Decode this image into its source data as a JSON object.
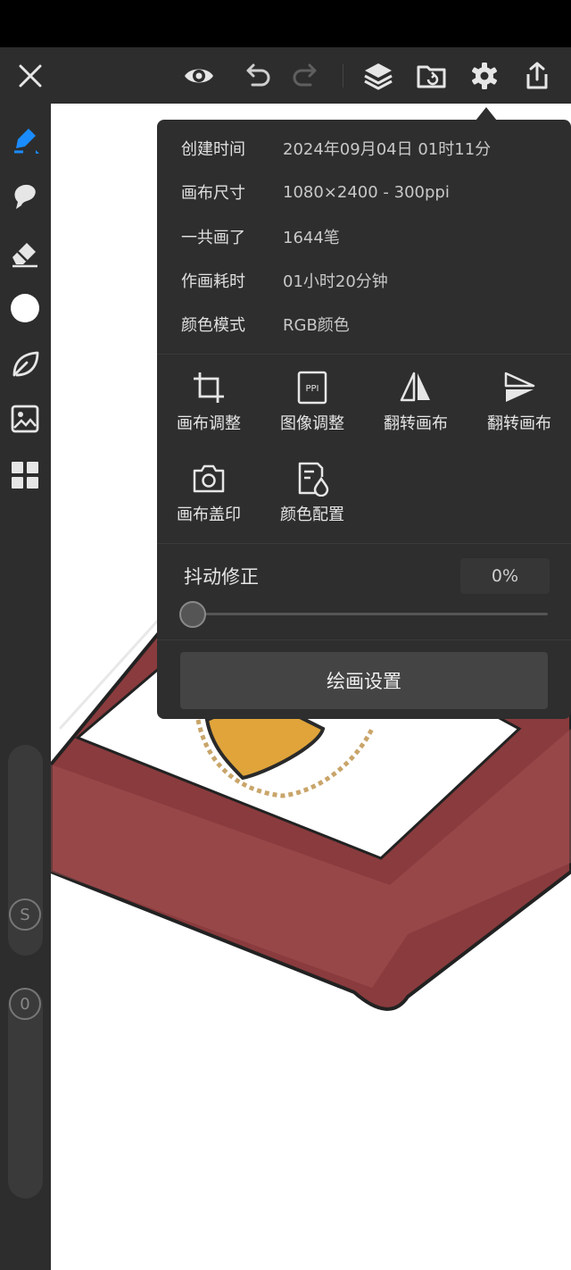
{
  "info": [
    {
      "label": "创建时间",
      "value": "2024年09月04日 01时11分"
    },
    {
      "label": "画布尺寸",
      "value": "1080×2400 - 300ppi"
    },
    {
      "label": "一共画了",
      "value": "1644笔"
    },
    {
      "label": "作画耗时",
      "value": "01小时20分钟"
    },
    {
      "label": "颜色模式",
      "value": "RGB颜色"
    }
  ],
  "actions": [
    {
      "label": "画布调整",
      "icon": "crop-icon"
    },
    {
      "label": "图像调整",
      "icon": "ppi-icon"
    },
    {
      "label": "翻转画布",
      "icon": "flip-horizontal-icon"
    },
    {
      "label": "翻转画布",
      "icon": "flip-vertical-icon"
    },
    {
      "label": "画布盖印",
      "icon": "camera-icon"
    },
    {
      "label": "颜色配置",
      "icon": "color-profile-icon"
    }
  ],
  "stabilizer": {
    "label": "抖动修正",
    "value": "0%",
    "level": 0
  },
  "paint_settings_label": "绘画设置",
  "ppi_icon_text": "PPI",
  "sidebar": {
    "size_badge": "S",
    "opacity_badge": "0"
  },
  "colors": {
    "accent": "#1a8cff",
    "panel": "#2e2e2e",
    "toolbar": "#2d2d2d",
    "frame_red": "#8b3a3a"
  }
}
